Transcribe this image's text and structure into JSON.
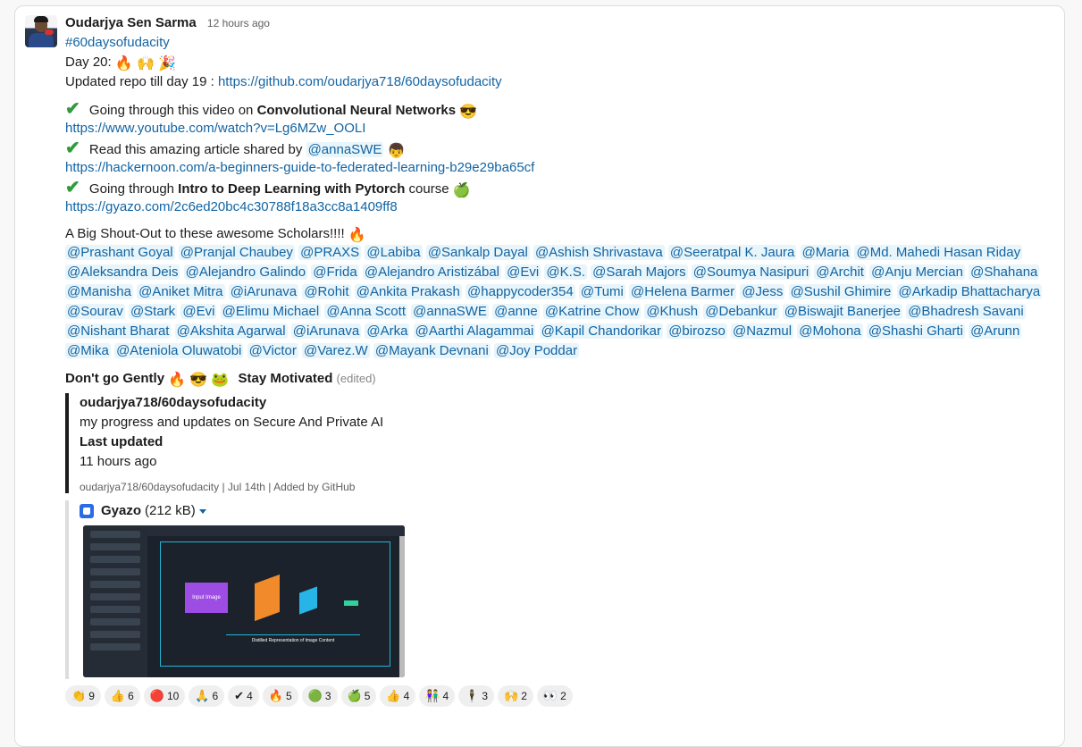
{
  "message": {
    "author": "Oudarjya Sen Sarma",
    "timestamp": "12 hours ago",
    "hashtag": "#60daysofudacity",
    "day_label": "Day 20:",
    "day_emojis": [
      "🔥",
      "🙌",
      "🎉"
    ],
    "repo_prefix": "Updated repo till day 19 : ",
    "repo_link": "https://github.com/oudarjya718/60daysofudacity",
    "items": [
      {
        "check": "✔",
        "text_prefix": "  Going through this video on ",
        "bold": "Convolutional Neural Networks",
        "emoji": "😎",
        "link": "https://www.youtube.com/watch?v=Lg6MZw_OOLI"
      },
      {
        "check": "✔",
        "text_prefix": "  Read this amazing article shared by ",
        "mention": "@annaSWE",
        "emoji": "👦",
        "link": "https://hackernoon.com/a-beginners-guide-to-federated-learning-b29e29ba65cf"
      },
      {
        "check": "✔",
        "text_prefix": " Going through ",
        "bold": "Intro to Deep Learning with Pytorch",
        "suffix": " course",
        "emoji": "🍏",
        "link": "https://gyazo.com/2c6ed20bc4c30788f18a3cc8a1409ff8"
      }
    ],
    "shoutout": "A Big Shout-Out to these awesome Scholars!!!!",
    "shoutout_emoji": "🔥",
    "mentions": [
      "@Prashant Goyal",
      "@Pranjal Chaubey",
      "@PRAXS",
      "@Labiba",
      "@Sankalp Dayal",
      "@Ashish Shrivastava",
      "@Seeratpal K. Jaura",
      "@Maria",
      "@Md. Mahedi Hasan Riday",
      "@Aleksandra Deis",
      "@Alejandro Galindo",
      "@Frida",
      "@Alejandro Aristizábal",
      "@Evi",
      "@K.S.",
      "@Sarah Majors",
      "@Soumya Nasipuri",
      "@Archit",
      "@Anju Mercian",
      "@Shahana",
      "@Manisha",
      "@Aniket Mitra",
      "@iArunava",
      "@Rohit",
      "@Ankita Prakash",
      "@happycoder354",
      "@Tumi",
      "@Helena Barmer",
      "@Jess",
      "@Sushil Ghimire",
      "@Arkadip Bhattacharya",
      "@Sourav",
      "@Stark",
      "@Evi",
      "@Elimu Michael",
      "@Anna Scott",
      "@annaSWE",
      "@anne",
      "@Katrine Chow",
      "@Khush",
      "@Debankur",
      "@Biswajit Banerjee",
      "@Bhadresh Savani",
      "@Nishant Bharat",
      "@Akshita Agarwal",
      "@iArunava",
      "@Arka",
      "@Aarthi Alagammai",
      "@Kapil Chandorikar",
      "@birozso",
      "@Nazmul",
      "@Mohona",
      "@Shashi Gharti",
      "@Arunn",
      "@Mika",
      "@Ateniola Oluwatobi",
      "@Victor",
      "@Varez.W",
      "@Mayank Devnani",
      "@Joy Poddar"
    ],
    "closing": {
      "text1": "Don't go Gently",
      "emojis": [
        "🔥",
        "😎",
        "🐸"
      ],
      "text2": "Stay Motivated",
      "edited": "(edited)"
    }
  },
  "attachment": {
    "title": "oudarjya718/60daysofudacity",
    "description": "my progress and updates on Secure And Private AI",
    "field_label": "Last updated",
    "field_value": "11 hours ago",
    "footer_repo": "oudarjya718/60daysofudacity",
    "footer_date": "Jul 14th",
    "footer_source": "Added by GitHub"
  },
  "gyazo": {
    "name": "Gyazo",
    "size": "(212 kB)",
    "preview_label": "Input Image",
    "preview_caption": "Distilled Representation of Image Content"
  },
  "reactions": [
    {
      "emoji": "👏",
      "count": "9"
    },
    {
      "emoji": "👍",
      "count": "6"
    },
    {
      "emoji": "🔴",
      "count": "10"
    },
    {
      "emoji": "🙏",
      "count": "6"
    },
    {
      "emoji": "✔",
      "count": "4"
    },
    {
      "emoji": "🔥",
      "count": "5"
    },
    {
      "emoji": "🟢",
      "count": "3"
    },
    {
      "emoji": "🍏",
      "count": "5"
    },
    {
      "emoji": "👍",
      "count": "4"
    },
    {
      "emoji": "👫",
      "count": "4"
    },
    {
      "emoji": "🕴",
      "count": "3"
    },
    {
      "emoji": "🙌",
      "count": "2"
    },
    {
      "emoji": "👀",
      "count": "2"
    }
  ]
}
